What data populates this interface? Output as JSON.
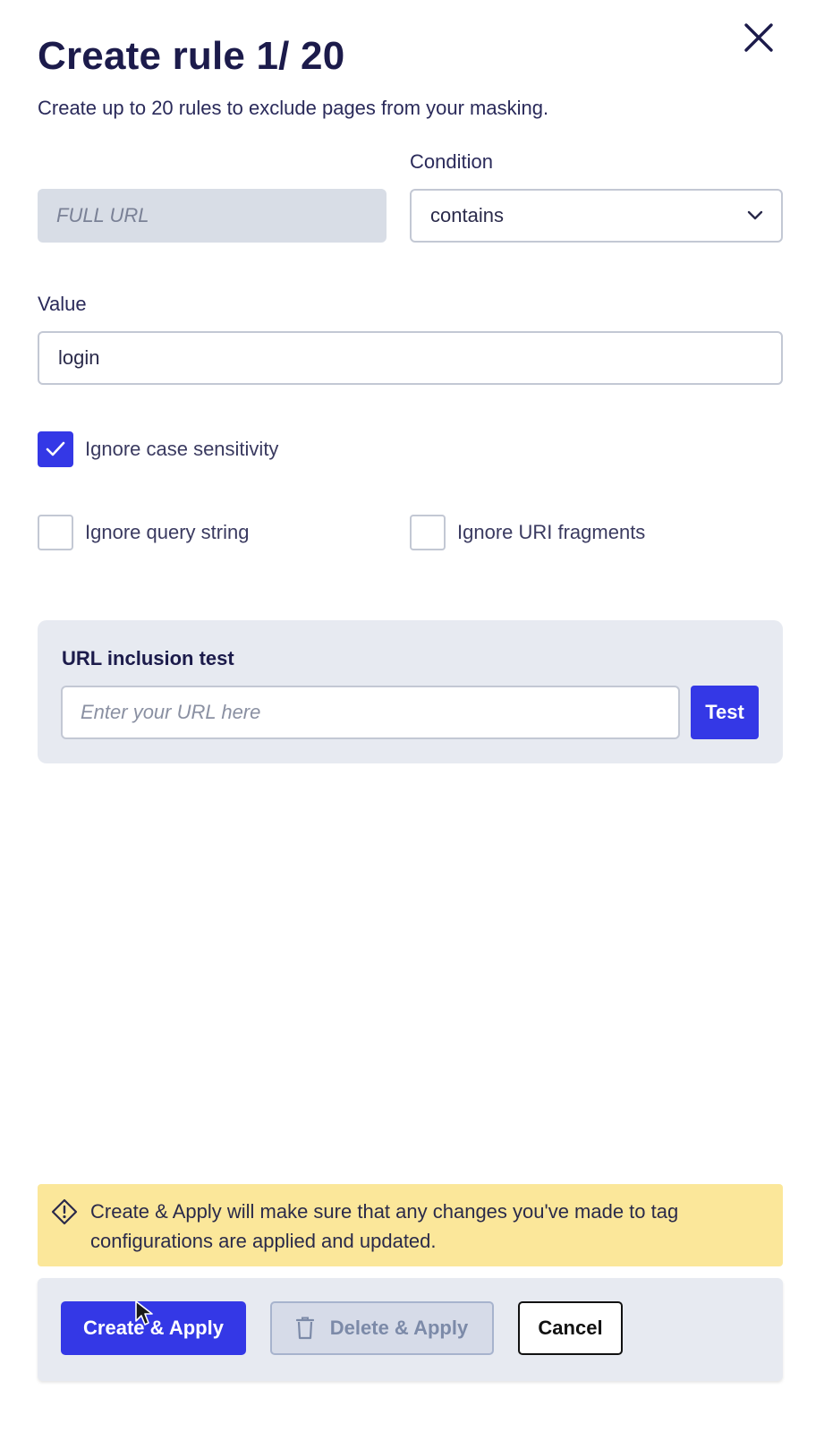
{
  "dialog": {
    "title": "Create rule 1/ 20",
    "subtitle": "Create up to 20 rules to exclude pages from your masking."
  },
  "close_icon": "close-icon",
  "rule": {
    "field_placeholder": "FULL URL",
    "condition_label": "Condition",
    "condition_value": "contains",
    "value_label": "Value",
    "value": "login"
  },
  "options": {
    "ignore_case": {
      "label": "Ignore case sensitivity",
      "checked": true
    },
    "ignore_query": {
      "label": "Ignore query string",
      "checked": false
    },
    "ignore_uri_fragments": {
      "label": "Ignore URI fragments",
      "checked": false
    }
  },
  "url_test": {
    "title": "URL inclusion test",
    "placeholder": "Enter your URL here",
    "button_label": "Test"
  },
  "notice": {
    "icon": "warning-diamond-icon",
    "text": "Create & Apply will make sure that any changes you've made to tag configurations are applied and updated."
  },
  "footer": {
    "create_label": "Create & Apply",
    "delete_label": "Delete & Apply",
    "cancel_label": "Cancel"
  },
  "colors": {
    "primary": "#3438e6",
    "notice_bg": "#fbe79a",
    "card_bg": "#e7eaf1",
    "title": "#1c1b4b"
  }
}
